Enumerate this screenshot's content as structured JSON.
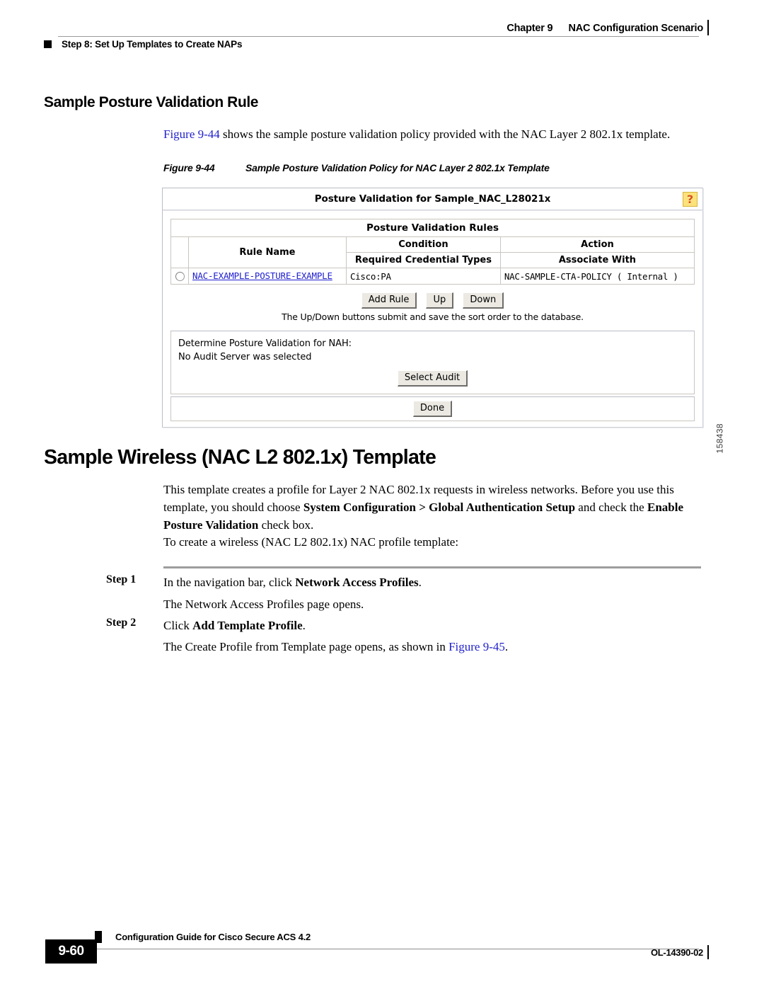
{
  "header": {
    "chapter": "Chapter 9",
    "chapter_title": "NAC Configuration Scenario",
    "running_head": "Step 8: Set Up Templates to Create NAPs"
  },
  "section_posture": {
    "heading": "Sample Posture Validation Rule",
    "intro_xref": "Figure 9-44",
    "intro_rest": " shows the sample posture validation policy provided with the NAC Layer 2 802.1x template."
  },
  "figure": {
    "caption_number": "Figure 9-44",
    "caption_title": "Sample Posture Validation Policy for NAC Layer 2 802.1x Template",
    "figure_id": "158438",
    "app": {
      "window_title": "Posture Validation for Sample_NAC_L28021x",
      "help_icon_glyph": "?",
      "table_title": "Posture Validation Rules",
      "headers_row1": [
        "",
        "Rule Name",
        "Condition",
        "Action"
      ],
      "headers_row2": [
        "Required Credential Types",
        "Associate With"
      ],
      "rows": [
        {
          "selected": false,
          "rule_name": "NAC-EXAMPLE-POSTURE-EXAMPLE",
          "required_credential_types": "Cisco:PA",
          "associate_with": "NAC-SAMPLE-CTA-POLICY ( Internal )"
        }
      ],
      "buttons": {
        "add_rule": "Add Rule",
        "up": "Up",
        "down": "Down",
        "select_audit": "Select Audit",
        "done": "Done"
      },
      "sort_note": "The Up/Down buttons submit and save the sort order to the database.",
      "audit_label": "Determine Posture Validation for NAH:",
      "audit_status": "No Audit Server was selected"
    }
  },
  "section_wireless": {
    "heading": "Sample Wireless (NAC L2 802.1x) Template",
    "para1_a": "This template creates a profile for Layer 2 NAC 802.1x requests in wireless networks. Before you use this template, you should choose ",
    "para1_bold1": "System Configuration > Global Authentication Setup",
    "para1_b": " and check the ",
    "para1_bold2": "Enable Posture Validation",
    "para1_c": " check box.",
    "para2": "To create a wireless (NAC L2 802.1x) NAC profile template:"
  },
  "steps": [
    {
      "label": "Step 1",
      "text_a": "In the navigation bar, click ",
      "bold": "Network Access Profiles",
      "text_b": ".",
      "result": "The Network Access Profiles page opens."
    },
    {
      "label": "Step 2",
      "text_a": "Click ",
      "bold": "Add Template Profile",
      "text_b": ".",
      "result_a": "The Create Profile from Template page opens, as shown in ",
      "result_xref": "Figure 9-45",
      "result_b": "."
    }
  ],
  "footer": {
    "guide_title": "Configuration Guide for Cisco Secure ACS 4.2",
    "page_number": "9-60",
    "doc_number": "OL-14390-02"
  },
  "colors": {
    "xref_blue": "#2222cc",
    "link_blue": "#2020d0",
    "help_yellow": "#fbe27a",
    "help_orange": "#d8541f"
  }
}
